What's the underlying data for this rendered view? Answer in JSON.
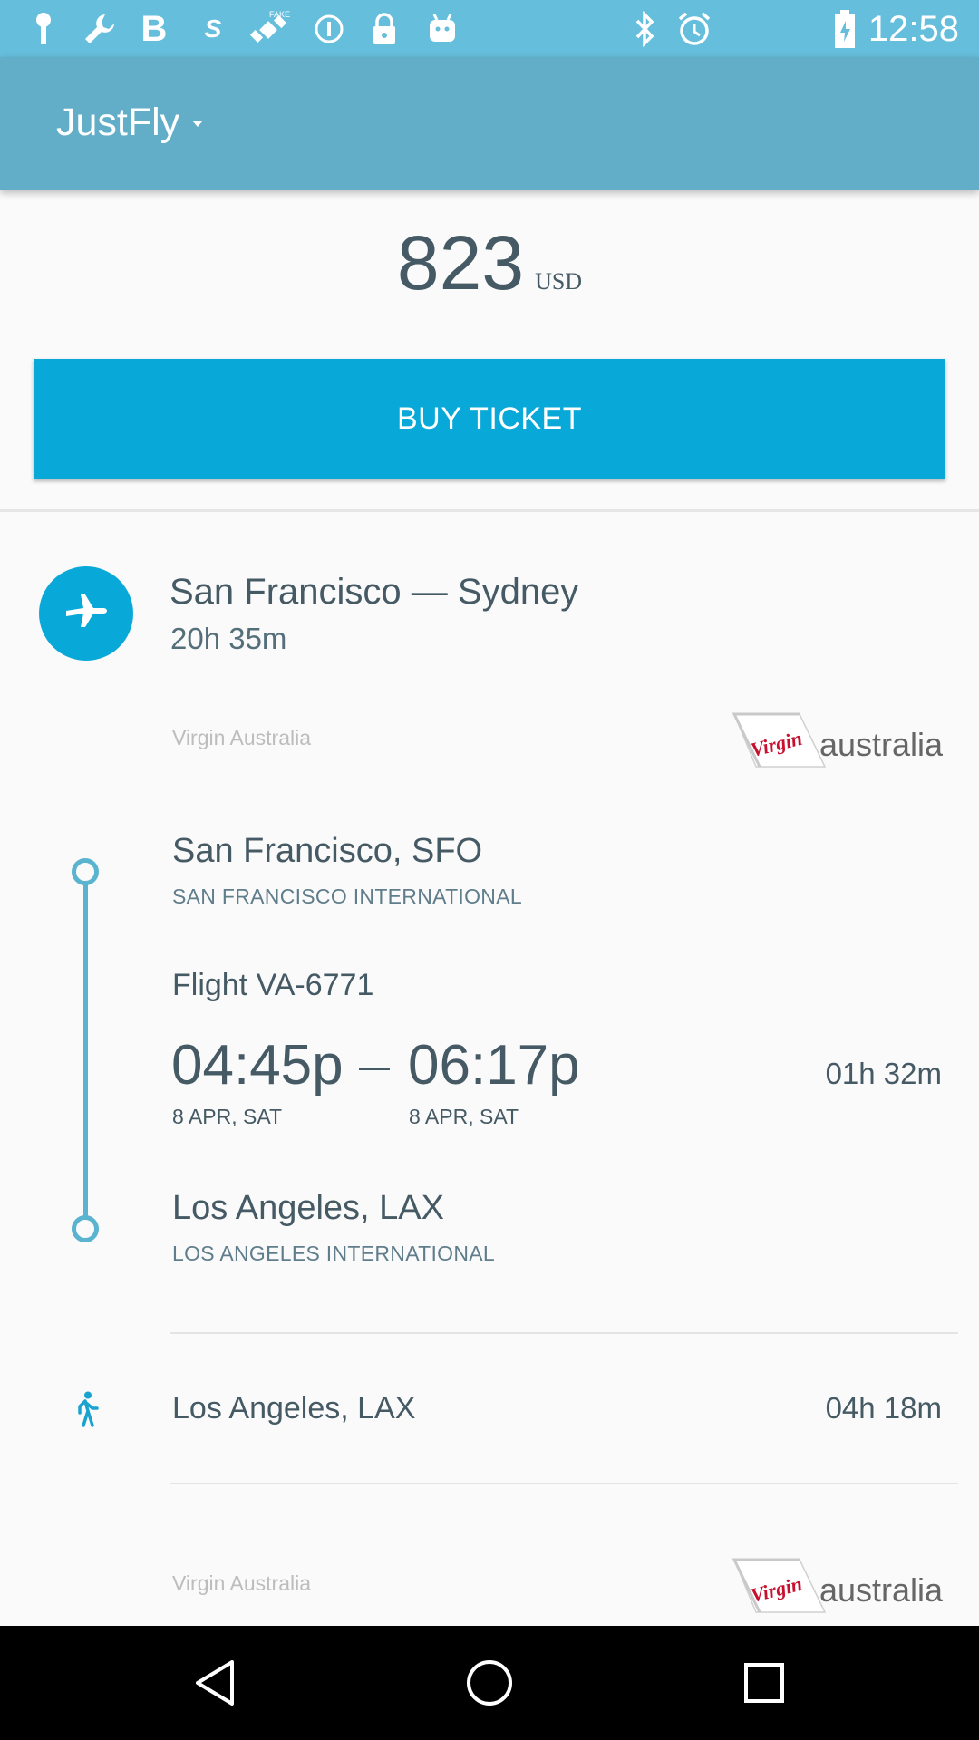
{
  "status_bar": {
    "time": "12:58",
    "left_icons": [
      "key-icon",
      "wrench-icon",
      "bold-b-icon",
      "sprint-icon",
      "fake-gps-satellite-icon",
      "info-circle-icon",
      "lock-icon",
      "android-icon"
    ],
    "right_icons": [
      "bluetooth-icon",
      "alarm-icon",
      "battery-icon"
    ]
  },
  "app_bar": {
    "title": "JustFly"
  },
  "price": {
    "amount": "823",
    "currency": "USD"
  },
  "buy_button": {
    "label": "BUY TICKET"
  },
  "route": {
    "title": "San Francisco — Sydney",
    "duration": "20h 35m",
    "icon": "airplane-icon"
  },
  "segments": [
    {
      "airline": "Virgin Australia",
      "logo_word": "Virgin",
      "logo_text": "australia",
      "departure": {
        "city": "San Francisco, SFO",
        "airport": "SAN FRANCISCO INTERNATIONAL",
        "time": "04:45p",
        "date": "8 APR, SAT"
      },
      "flight": "Flight VA-6771",
      "arrival": {
        "city": "Los Angeles, LAX",
        "airport": "LOS ANGELES INTERNATIONAL",
        "time": "06:17p",
        "date": "8 APR, SAT"
      },
      "duration": "01h 32m"
    }
  ],
  "layover": {
    "city": "Los Angeles, LAX",
    "duration": "04h 18m",
    "icon": "walking-person-icon"
  },
  "next_segment": {
    "airline": "Virgin Australia",
    "logo_word": "Virgin",
    "logo_text": "australia"
  },
  "colors": {
    "accent": "#08a9d9",
    "app_bar": "#62aec8",
    "status_bar": "#65bedc",
    "timeline": "#5ab4cf",
    "logo_red": "#c8102e"
  },
  "nav_bar": {
    "buttons": [
      "back-icon",
      "home-icon",
      "recents-icon"
    ]
  }
}
